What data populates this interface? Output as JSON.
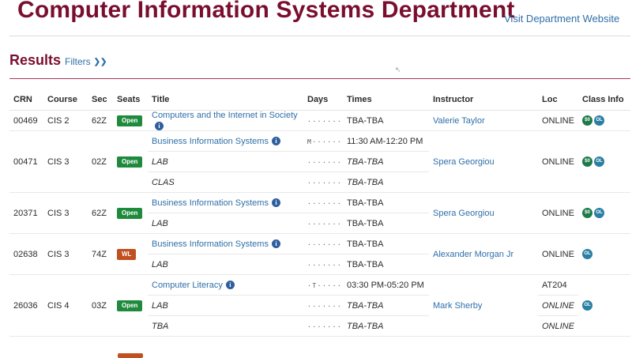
{
  "header": {
    "title": "Computer Information Systems Department",
    "website_link": "Visit Department Website"
  },
  "results": {
    "title": "Results",
    "filters_label": "Filters",
    "filters_icon": "double-chevron-down-icon"
  },
  "colors": {
    "brand": "#7a0e2e",
    "link": "#2f6fa8",
    "open": "#1e8a3c",
    "waitlist": "#c0501f",
    "icon_dollar": "#1e7a4a",
    "icon_online": "#2a7fa3"
  },
  "table": {
    "columns": [
      "CRN",
      "Course",
      "Sec",
      "Seats",
      "Title",
      "Days",
      "Times",
      "Instructor",
      "Loc",
      "Class Info"
    ],
    "rows": [
      {
        "crn": "00469",
        "course": "CIS 2",
        "sec": "62Z",
        "seats": "Open",
        "title": "Computers and the Internet in Society",
        "days": "·······",
        "times": "TBA-TBA",
        "instructor": "Valerie Taylor",
        "loc": "ONLINE",
        "info": [
          "$0",
          "OL"
        ]
      },
      {
        "crn": "00471",
        "course": "CIS 3",
        "sec": "02Z",
        "seats": "Open",
        "title": "Business Information Systems",
        "days": "M······",
        "times": "11:30 AM-12:20 PM",
        "instructor": "Spera Georgiou",
        "loc": "ONLINE",
        "info": [
          "$0",
          "OL"
        ]
      },
      {
        "sub1_label": "LAB",
        "sub1_days": "·······",
        "sub1_times": "TBA-TBA",
        "sub2_label": "CLAS",
        "sub2_days": "·······",
        "sub2_times": "TBA-TBA"
      },
      {
        "crn": "20371",
        "course": "CIS 3",
        "sec": "62Z",
        "seats": "Open",
        "title": "Business Information Systems",
        "days": "·······",
        "times": "TBA-TBA",
        "instructor": "Spera Georgiou",
        "loc": "ONLINE",
        "info": [
          "$0",
          "OL"
        ],
        "sub_label": "LAB",
        "sub_days": "·······",
        "sub_times": "TBA-TBA"
      },
      {
        "crn": "02638",
        "course": "CIS 3",
        "sec": "74Z",
        "seats": "WL",
        "title": "Business Information Systems",
        "days": "·······",
        "times": "TBA-TBA",
        "instructor": "Alexander Morgan Jr",
        "loc": "ONLINE",
        "info": [
          "OL"
        ],
        "sub_label": "LAB",
        "sub_days": "·······",
        "sub_times": "TBA-TBA"
      },
      {
        "crn": "26036",
        "course": "CIS 4",
        "sec": "03Z",
        "seats": "Open",
        "title": "Computer Literacy",
        "days": "·T·····",
        "times": "03:30 PM-05:20 PM",
        "instructor": "Mark Sherby",
        "loc": "AT204",
        "info": [
          "OL"
        ],
        "sub1_label": "LAB",
        "sub1_days": "·······",
        "sub1_times": "TBA-TBA",
        "sub1_loc": "ONLINE",
        "sub2_label": "TBA",
        "sub2_days": "·······",
        "sub2_times": "TBA-TBA",
        "sub2_loc": "ONLINE"
      }
    ]
  }
}
